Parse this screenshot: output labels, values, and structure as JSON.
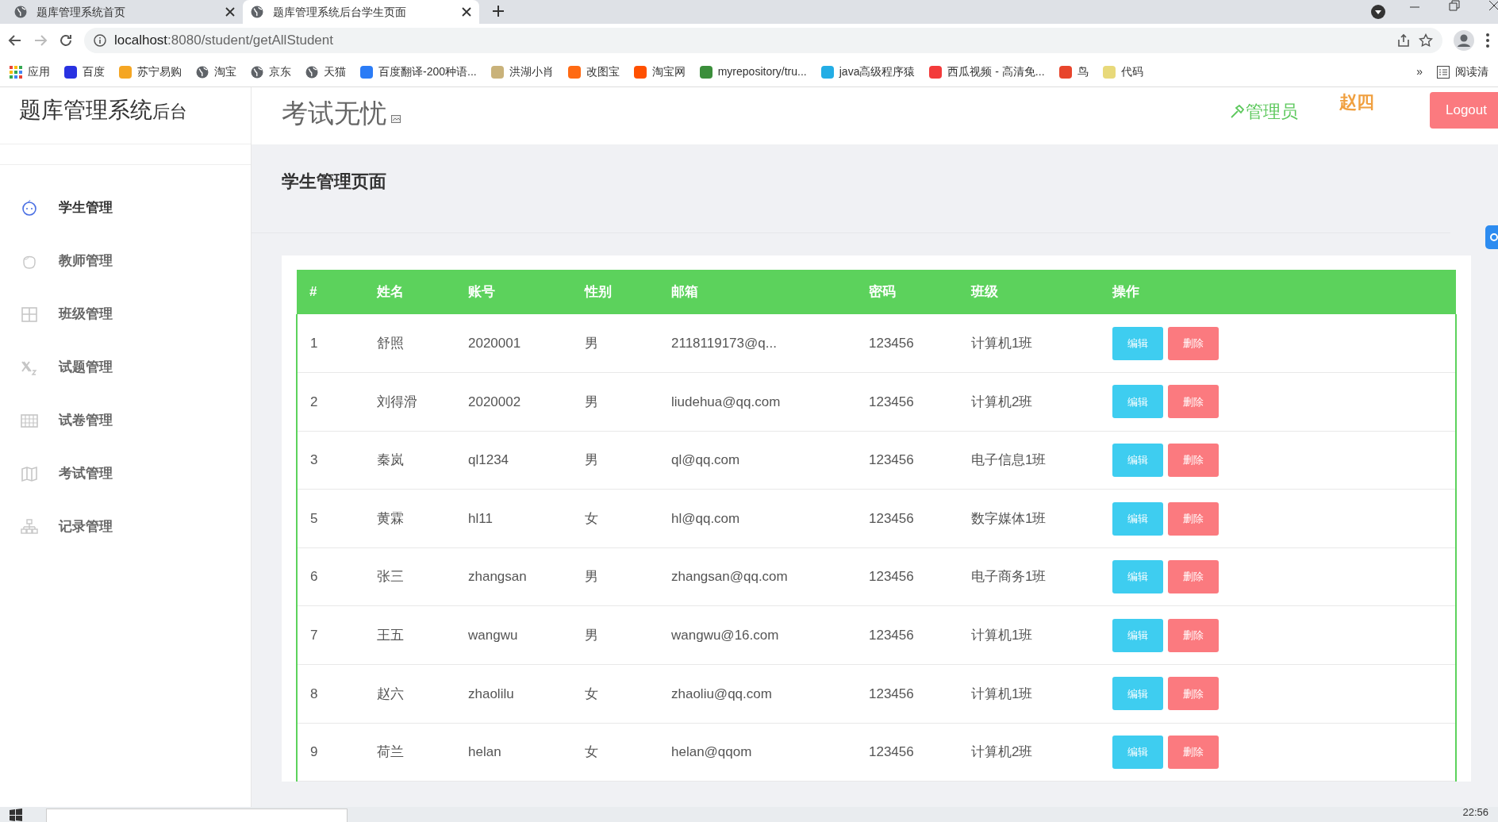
{
  "browser": {
    "tabs": [
      {
        "title": "题库管理系统首页",
        "selected": false
      },
      {
        "title": "题库管理系统后台学生页面",
        "selected": true
      }
    ],
    "url_host": "localhost",
    "url_path": ":8080/student/getAllStudent",
    "bookmarks": [
      {
        "label": "应用",
        "kind": "apps"
      },
      {
        "label": "百度",
        "kind": "logo",
        "color": "#2932e1"
      },
      {
        "label": "苏宁易购",
        "kind": "logo",
        "color": "#f5a623"
      },
      {
        "label": "淘宝",
        "kind": "globe"
      },
      {
        "label": "京东",
        "kind": "globe"
      },
      {
        "label": "天猫",
        "kind": "globe"
      },
      {
        "label": "百度翻译-200种语...",
        "kind": "logo",
        "color": "#2b7cf6"
      },
      {
        "label": "洪湖小肖",
        "kind": "logo",
        "color": "#c9b27a"
      },
      {
        "label": "改图宝",
        "kind": "logo",
        "color": "#ff6a13"
      },
      {
        "label": "淘宝网",
        "kind": "logo",
        "color": "#ff5000"
      },
      {
        "label": "myrepository/tru...",
        "kind": "logo",
        "color": "#3b8e3b"
      },
      {
        "label": "java高级程序猿",
        "kind": "logo",
        "color": "#23ade5"
      },
      {
        "label": "西瓜视频 - 高清免...",
        "kind": "logo",
        "color": "#f33b3b"
      },
      {
        "label": "鸟",
        "kind": "logo",
        "color": "#e8452c"
      },
      {
        "label": "代码",
        "kind": "logo",
        "color": "#e8d97a"
      }
    ],
    "more": "»",
    "reading_list": "阅读清"
  },
  "brand": {
    "main": "题库管理系统",
    "sub": "后台"
  },
  "header": {
    "title": "考试无忧",
    "role": "管理员",
    "user": "赵四",
    "logout": "Logout"
  },
  "sidebar": {
    "items": [
      {
        "label": "学生管理",
        "selected": true
      },
      {
        "label": "教师管理",
        "selected": false
      },
      {
        "label": "班级管理",
        "selected": false
      },
      {
        "label": "试题管理",
        "selected": false
      },
      {
        "label": "试卷管理",
        "selected": false
      },
      {
        "label": "考试管理",
        "selected": false
      },
      {
        "label": "记录管理",
        "selected": false
      }
    ]
  },
  "page_title": "学生管理页面",
  "table": {
    "columns": [
      "#",
      "姓名",
      "账号",
      "性别",
      "邮箱",
      "密码",
      "班级",
      "操作"
    ],
    "rows": [
      {
        "cells": [
          "1",
          "舒照",
          "2020001",
          "男",
          "2118119173@q...",
          "123456",
          "计算机1班"
        ],
        "actions": [
          "编辑",
          "删除"
        ]
      },
      {
        "cells": [
          "2",
          "刘得滑",
          "2020002",
          "男",
          "liudehua@qq.com",
          "123456",
          "计算机2班"
        ],
        "actions": [
          "编辑",
          "删除"
        ]
      },
      {
        "cells": [
          "3",
          "秦岚",
          "ql1234",
          "男",
          "ql@qq.com",
          "123456",
          "电子信息1班"
        ],
        "actions": [
          "编辑",
          "删除"
        ]
      },
      {
        "cells": [
          "5",
          "黄霖",
          "hl11",
          "女",
          "hl@qq.com",
          "123456",
          "数字媒体1班"
        ],
        "actions": [
          "编辑",
          "删除"
        ]
      },
      {
        "cells": [
          "6",
          "张三",
          "zhangsan",
          "男",
          "zhangsan@qq.com",
          "123456",
          "电子商务1班"
        ],
        "actions": [
          "编辑",
          "删除"
        ]
      },
      {
        "cells": [
          "7",
          "王五",
          "wangwu",
          "男",
          "wangwu@16.com",
          "123456",
          "计算机1班"
        ],
        "actions": [
          "编辑",
          "删除"
        ]
      },
      {
        "cells": [
          "8",
          "赵六",
          "zhaolilu",
          "女",
          "zhaoliu@qq.com",
          "123456",
          "计算机1班"
        ],
        "actions": [
          "编辑",
          "删除"
        ]
      },
      {
        "cells": [
          "9",
          "荷兰",
          "helan",
          "女",
          "helan@qqom",
          "123456",
          "计算机2班"
        ],
        "actions": [
          "编辑",
          "删除"
        ]
      }
    ]
  },
  "taskbar": {
    "clock": "22:56"
  }
}
